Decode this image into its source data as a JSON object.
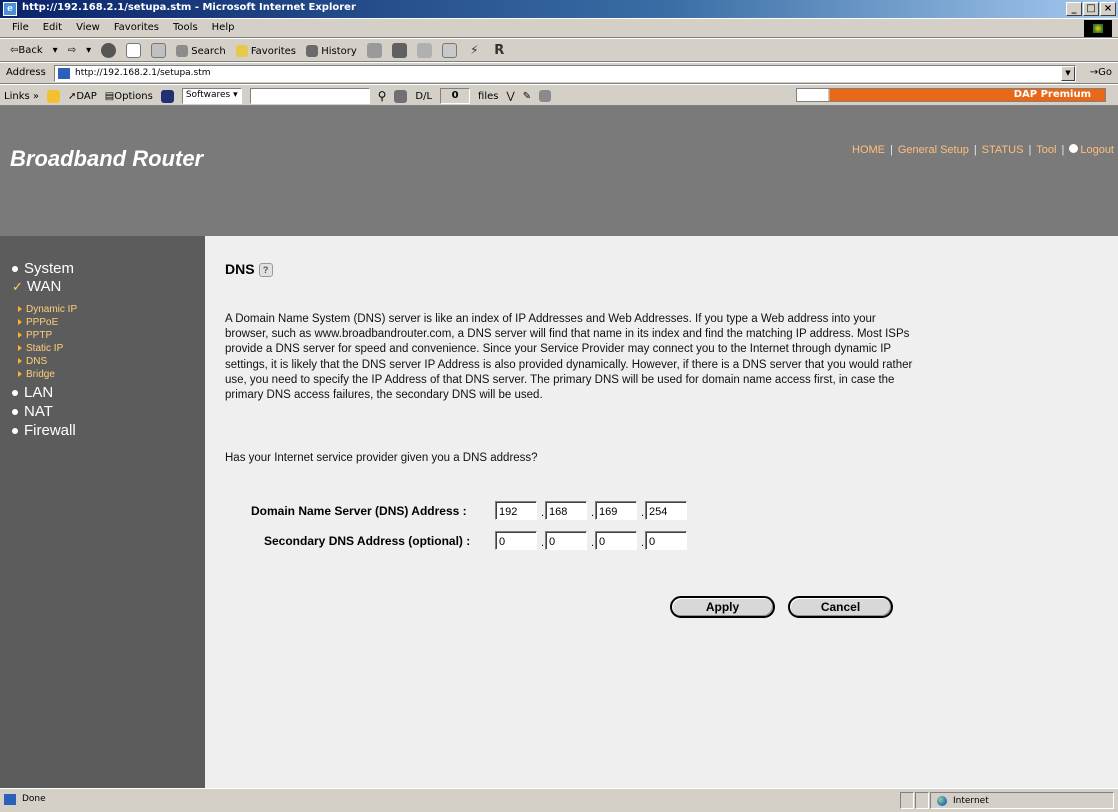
{
  "window": {
    "title": "http://192.168.2.1/setupa.stm - Microsoft Internet Explorer",
    "controls": [
      "_",
      "×"
    ]
  },
  "menu": [
    "File",
    "Edit",
    "View",
    "Favorites",
    "Tools",
    "Help"
  ],
  "toolbar": {
    "back": "⇦Back",
    "forward": "⇨",
    "search": "Search",
    "favorites": "Favorites",
    "history": "History"
  },
  "address": {
    "label": "Address",
    "value": "http://192.168.2.1/setupa.stm",
    "go": "Go"
  },
  "links_bar": {
    "links": "Links »",
    "dap": "DAP",
    "options": "Options",
    "softwares": "Softwares",
    "dl_label": "D/L",
    "dl_count": "0",
    "files_label": "files",
    "dap_premium": "DAP Premium"
  },
  "router": {
    "brand": "Broadband Router",
    "topnav": {
      "home": "HOME",
      "general_setup": "General Setup",
      "status": "STATUS",
      "tool": "Tool",
      "logout": "Logout"
    },
    "sidebar": {
      "system": "System",
      "wan": "WAN",
      "wan_items": [
        "Dynamic IP",
        "PPPoE",
        "PPTP",
        "Static IP",
        "DNS",
        "Bridge"
      ],
      "lan": "LAN",
      "nat": "NAT",
      "firewall": "Firewall"
    },
    "main": {
      "heading": "DNS",
      "description": "A Domain Name System (DNS) server is like an index of IP Addresses and Web Addresses. If you type a Web address into your browser, such as www.broadbandrouter.com, a DNS server will find that name in its index and find the matching IP address. Most ISPs provide a DNS server for speed and convenience. Since your Service Provider may connect you to the Internet through dynamic IP settings, it is likely that the DNS server IP Address is also provided dynamically. However, if there is a DNS server that you would rather use, you need to specify the IP Address of that DNS server. The primary DNS will be used for domain name access first, in case the primary DNS access failures, the secondary DNS will be used.",
      "question": "Has your Internet service provider given you a DNS address?",
      "primary_label": "Domain Name Server (DNS) Address :",
      "primary": [
        "192",
        "168",
        "169",
        "254"
      ],
      "secondary_label": "Secondary DNS Address (optional) :",
      "secondary": [
        "0",
        "0",
        "0",
        "0"
      ],
      "apply": "Apply",
      "cancel": "Cancel"
    }
  },
  "statusbar": {
    "text": "Done",
    "zone": "Internet"
  }
}
